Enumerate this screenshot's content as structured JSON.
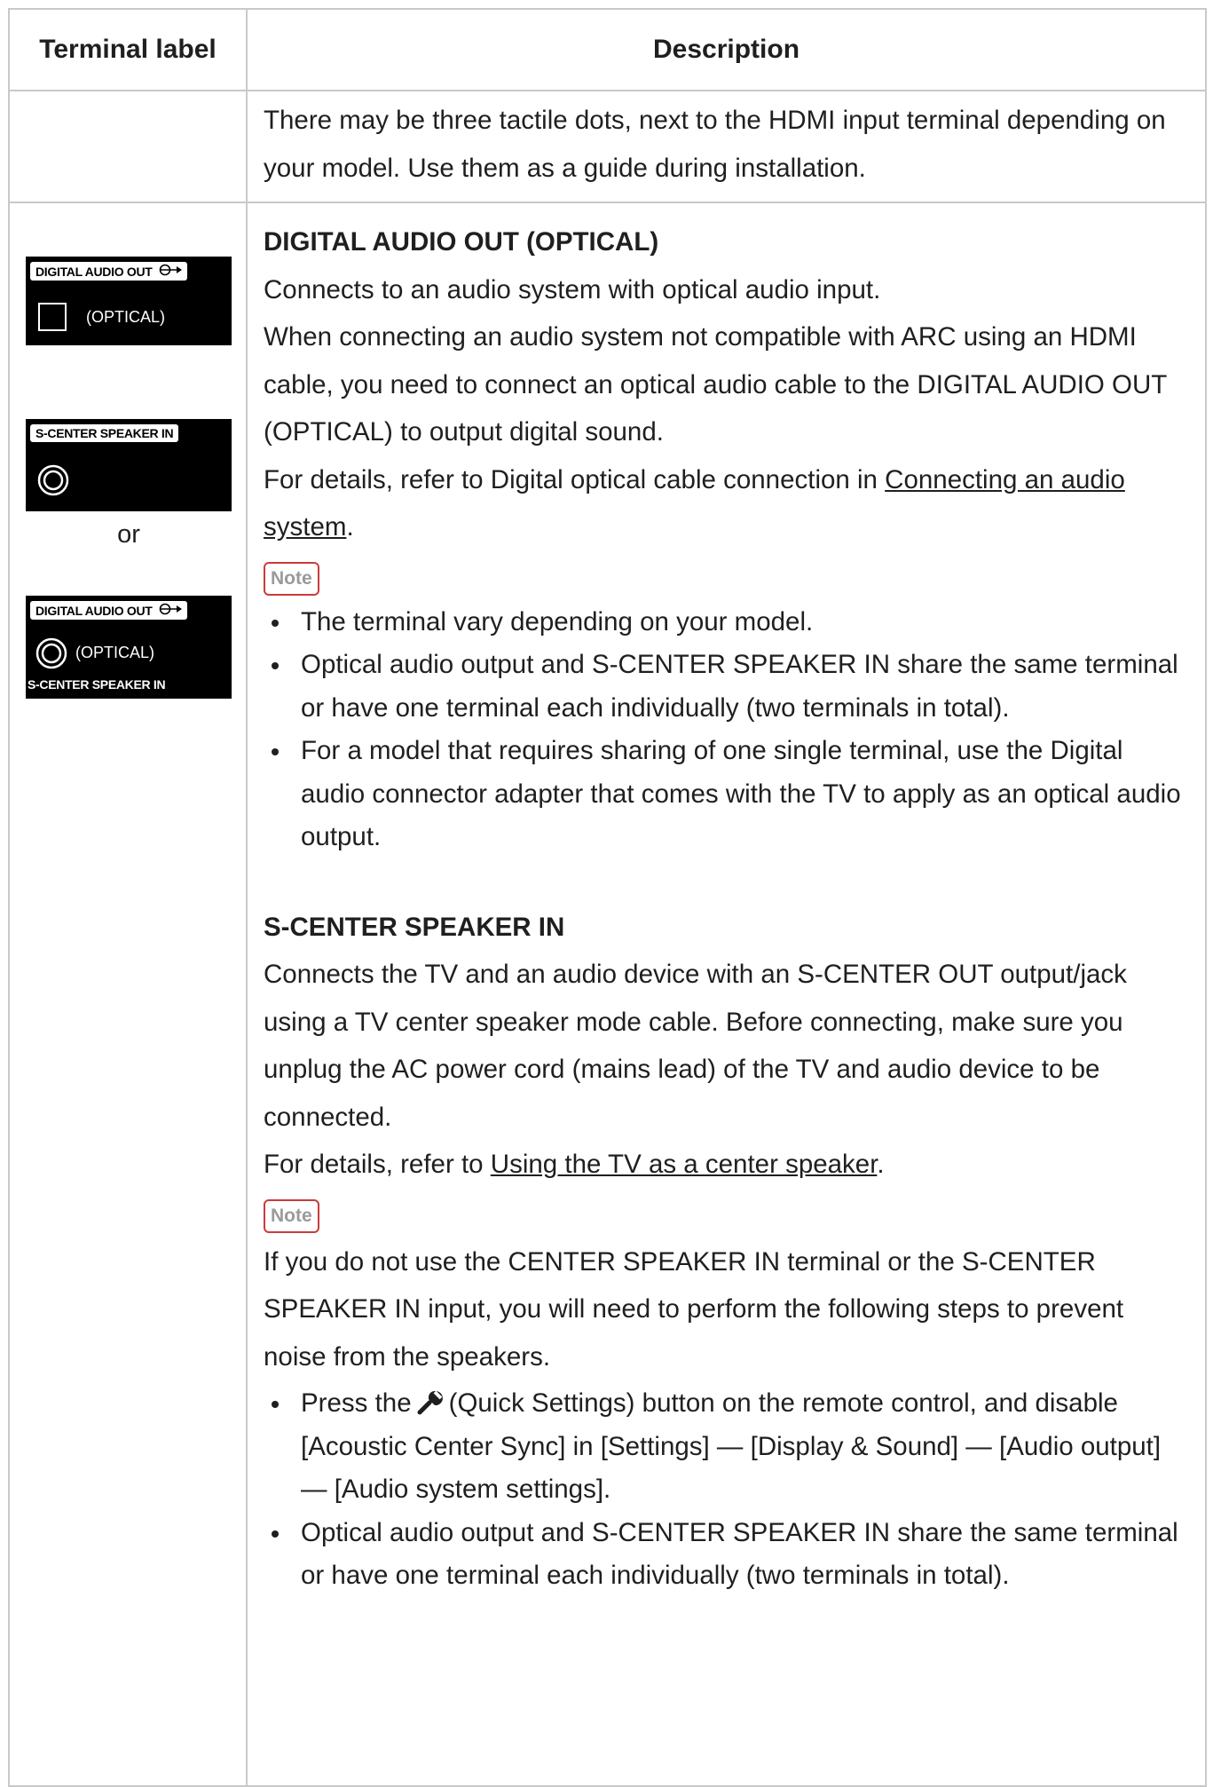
{
  "table": {
    "header": {
      "col1": "Terminal label",
      "col2": "Description"
    },
    "row1": {
      "text": "There may be three tactile dots, next to the HDMI input terminal depending on your model. Use them as a guide during installation."
    },
    "row2": {
      "labels": {
        "img1_title": "DIGITAL AUDIO OUT",
        "img1_caption": "(OPTICAL)",
        "img2_title": "S-CENTER  SPEAKER IN",
        "or": "or",
        "img3_title": "DIGITAL AUDIO OUT",
        "img3_caption": "(OPTICAL)",
        "img3_subcaption": "S-CENTER  SPEAKER IN"
      },
      "digital": {
        "heading": "DIGITAL AUDIO OUT (OPTICAL)",
        "p1": "Connects to an audio system with optical audio input.",
        "p2": "When connecting an audio system not compatible with ARC using an HDMI cable, you need to connect an optical audio cable to the DIGITAL AUDIO OUT (OPTICAL) to output digital sound.",
        "p3_prefix": "For details, refer to Digital optical cable connection in ",
        "p3_link": "Connecting an audio system",
        "p3_suffix": ".",
        "note_label": "Note",
        "bullets": [
          "The terminal vary depending on your model.",
          "Optical audio output and S-CENTER SPEAKER IN share the same terminal or have one terminal each individually (two terminals in total).",
          "For a model that requires sharing of one single terminal, use the Digital audio connector adapter that comes with the TV to apply as an optical audio output."
        ]
      },
      "scenter": {
        "heading": "S-CENTER SPEAKER IN",
        "p1": "Connects the TV and an audio device with an S-CENTER OUT output/jack using a TV center speaker mode cable. Before connecting, make sure you unplug the AC power cord (mains lead) of the TV and audio device to be connected.",
        "p2_prefix": "For details, refer to ",
        "p2_link": "Using the TV as a center speaker",
        "p2_suffix": ".",
        "note_label": "Note",
        "note_text": "If you do not use the CENTER SPEAKER IN terminal or the S-CENTER SPEAKER IN input, you will need to perform the following steps to prevent noise from the speakers.",
        "bullet1_prefix": "Press the",
        "bullet1_suffix": "(Quick Settings) button on the remote control, and disable [Acoustic Center Sync] in [Settings] — [Display & Sound] — [Audio output] — [Audio system settings].",
        "bullet2": "Optical audio output and S-CENTER SPEAKER IN share the same terminal or have one terminal each individually (two terminals in total)."
      }
    }
  },
  "icons": {
    "wrench": "wrench-icon",
    "optical_out": "arrow-out-icon"
  },
  "colors": {
    "note_border": "#cc3b3b",
    "table_border": "#c9c9c9",
    "text": "#1f1f1f"
  }
}
